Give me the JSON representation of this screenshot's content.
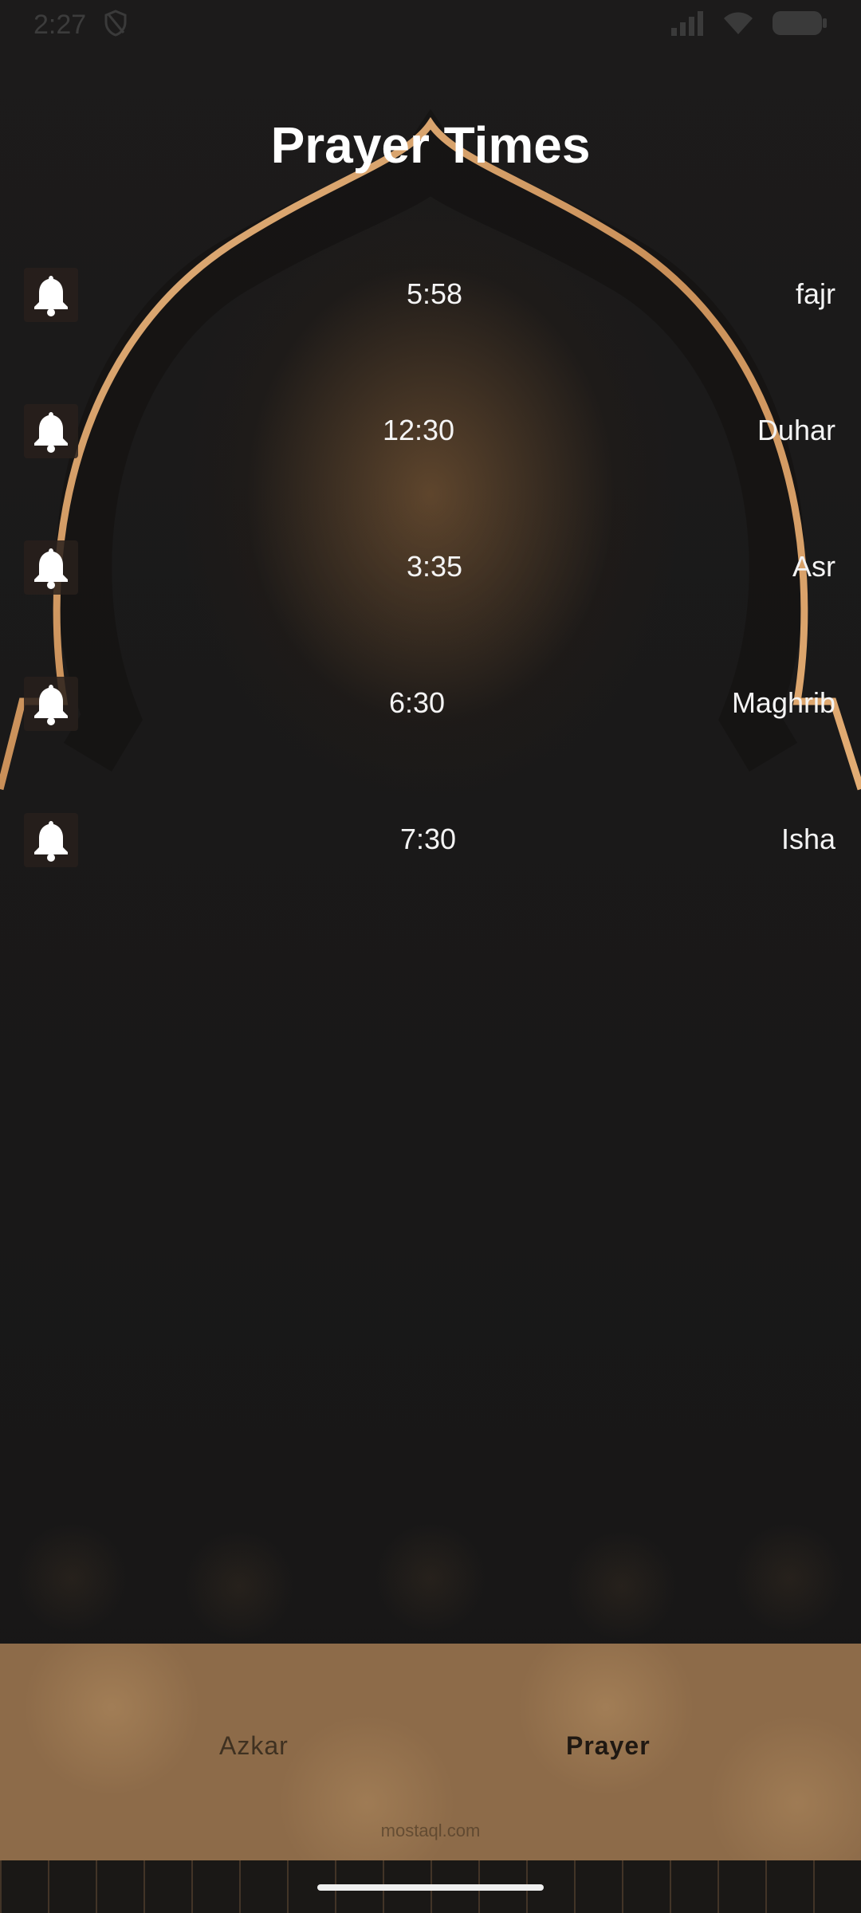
{
  "status_bar": {
    "time": "2:27"
  },
  "page": {
    "title": "Prayer Times"
  },
  "prayers": [
    {
      "name": "fajr",
      "time": "5:58"
    },
    {
      "name": "Duhar",
      "time": "12:30"
    },
    {
      "name": "Asr",
      "time": "3:35"
    },
    {
      "name": "Maghrib",
      "time": "6:30"
    },
    {
      "name": "Isha",
      "time": "7:30"
    }
  ],
  "bottom_nav": {
    "items": [
      {
        "label": "Azkar",
        "selected": false
      },
      {
        "label": "Prayer",
        "selected": true
      }
    ]
  },
  "watermark": "mostaql.com",
  "colors": {
    "background": "#1b1a1a",
    "accent_gold": "#d9a56e",
    "nav_background": "#8d6b49"
  }
}
